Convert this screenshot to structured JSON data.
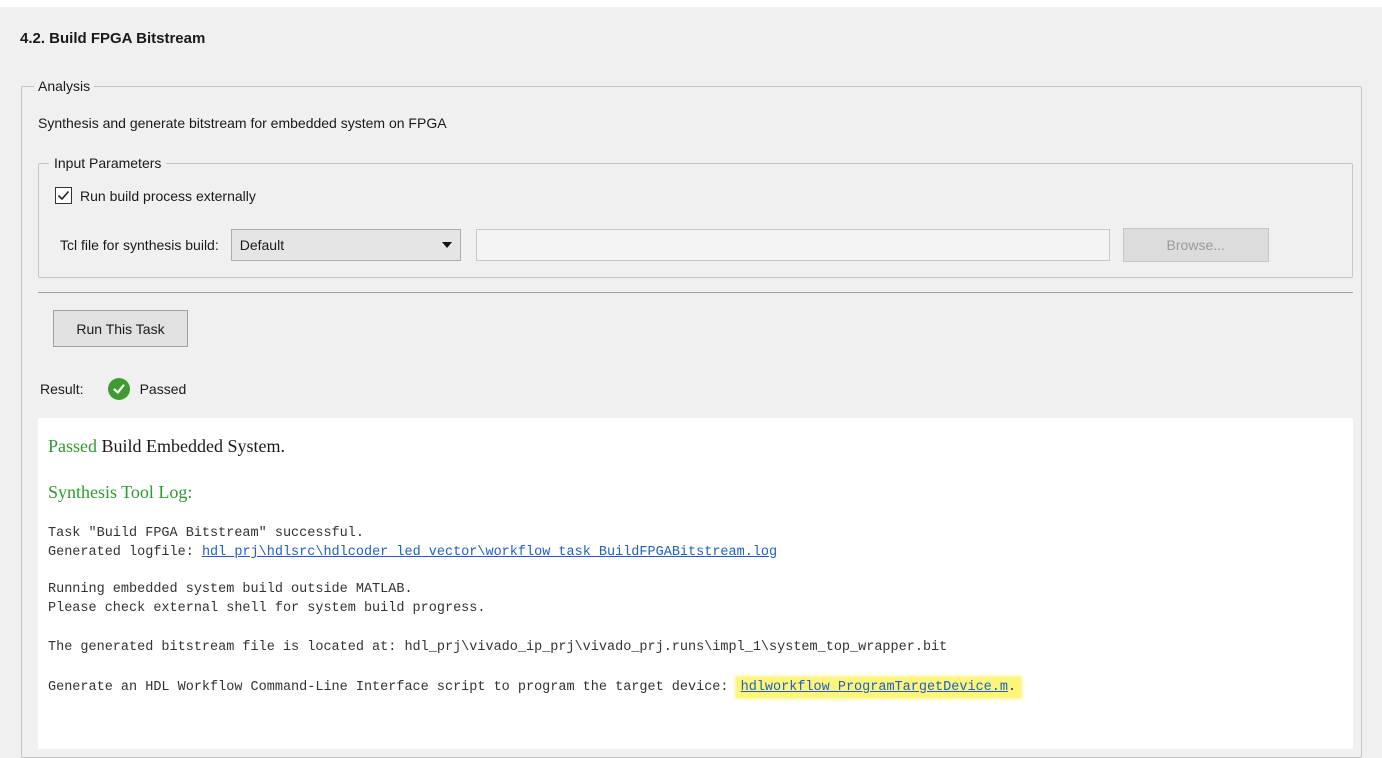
{
  "task": {
    "title": "4.2. Build FPGA Bitstream"
  },
  "analysis": {
    "legend": "Analysis",
    "description": "Synthesis and generate bitstream for embedded system on FPGA"
  },
  "input_parameters": {
    "legend": "Input Parameters",
    "run_externally_label": "Run build process externally",
    "run_externally_checked": true,
    "tcl_label": "Tcl file for synthesis build:",
    "tcl_select_value": "Default",
    "tcl_path_value": "",
    "browse_label": "Browse..."
  },
  "run_button_label": "Run This Task",
  "result": {
    "label": "Result:",
    "status": "Passed",
    "status_color": "#3e9b2f"
  },
  "log": {
    "heading_status": "Passed",
    "heading_text": " Build Embedded System.",
    "synthesis_heading": "Synthesis Tool Log:",
    "line1": "Task \"Build FPGA Bitstream\" successful.",
    "line2_prefix": "Generated logfile: ",
    "line2_link": "hdl_prj\\hdlsrc\\hdlcoder_led_vector\\workflow_task_BuildFPGABitstream.log",
    "line3": "Running embedded system build outside MATLAB.",
    "line4": "Please check external shell for system build progress.",
    "line5": "The generated bitstream file is located at: hdl_prj\\vivado_ip_prj\\vivado_prj.runs\\impl_1\\system_top_wrapper.bit",
    "line6_prefix": "Generate an HDL Workflow Command-Line Interface script to program the target device: ",
    "line6_link": "hdlworkflow_ProgramTargetDevice.m",
    "line6_suffix": "."
  },
  "colors": {
    "link": "#1f5fc7",
    "green_text": "#2f9a2f",
    "highlight": "#fcf57a"
  }
}
